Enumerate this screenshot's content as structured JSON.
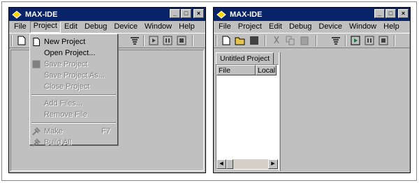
{
  "left_window": {
    "title": "MAX-IDE",
    "menu": [
      "File",
      "Project",
      "Edit",
      "Debug",
      "Device",
      "Window",
      "Help"
    ],
    "open_menu": "Project",
    "dropdown": {
      "new_project": "New Project",
      "open_project": "Open Project...",
      "save_project": "Save Project",
      "save_project_as": "Save Project As...",
      "close_project": "Close Project",
      "add_files": "Add Files...",
      "remove_file": "Remove File",
      "make": "Make",
      "make_shortcut": "F7",
      "build_all": "Build All"
    }
  },
  "right_window": {
    "title": "MAX-IDE",
    "menu": [
      "File",
      "Project",
      "Edit",
      "Debug",
      "Device",
      "Window",
      "Help"
    ],
    "tab_label": "Untitled Project",
    "columns": [
      "File",
      "Local"
    ]
  },
  "colors": {
    "titlebar": "#0a246a",
    "chrome": "#c0c0c0",
    "disabled_text": "#808080"
  }
}
